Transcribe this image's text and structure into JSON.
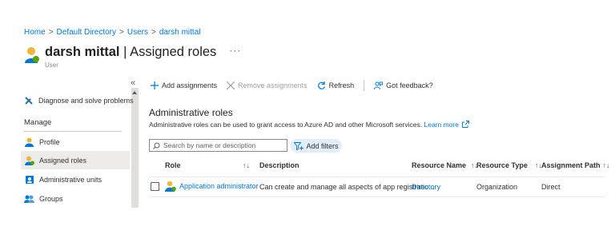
{
  "breadcrumb": [
    "Home",
    "Default Directory",
    "Users",
    "darsh mittal"
  ],
  "header": {
    "name": "darsh mittal",
    "separator": " | ",
    "title": "Assigned roles",
    "more": "···",
    "subtitle": "User"
  },
  "sidebar": {
    "collapse": "«",
    "diagnose": "Diagnose and solve problems",
    "section": "Manage",
    "items": [
      {
        "label": "Profile",
        "icon": "user-icon"
      },
      {
        "label": "Assigned roles",
        "icon": "role-user-icon",
        "selected": true
      },
      {
        "label": "Administrative units",
        "icon": "admin-units-icon"
      },
      {
        "label": "Groups",
        "icon": "groups-icon"
      }
    ]
  },
  "toolbar": {
    "add": "Add assignments",
    "remove": "Remove assignments",
    "refresh": "Refresh",
    "feedback": "Got feedback?"
  },
  "section": {
    "title": "Administrative roles",
    "desc": "Administrative roles can be used to grant access to Azure AD and other Microsoft services.",
    "learn_more": "Learn more"
  },
  "search": {
    "placeholder": "Search by name or description"
  },
  "filters": {
    "label": "Add filters"
  },
  "table": {
    "columns": [
      "Role",
      "Description",
      "Resource Name",
      "Resource Type",
      "Assignment Path"
    ],
    "sort_glyph": "↑↓",
    "rows": [
      {
        "role": "Application administrator",
        "description": "Can create and manage all aspects of app registratio...",
        "resource_name": "Directory",
        "resource_type": "Organization",
        "assignment_path": "Direct"
      }
    ]
  },
  "colors": {
    "accent": "#0078d4",
    "selected_bg": "#edebe9",
    "pill_bg": "#e1eefa"
  }
}
